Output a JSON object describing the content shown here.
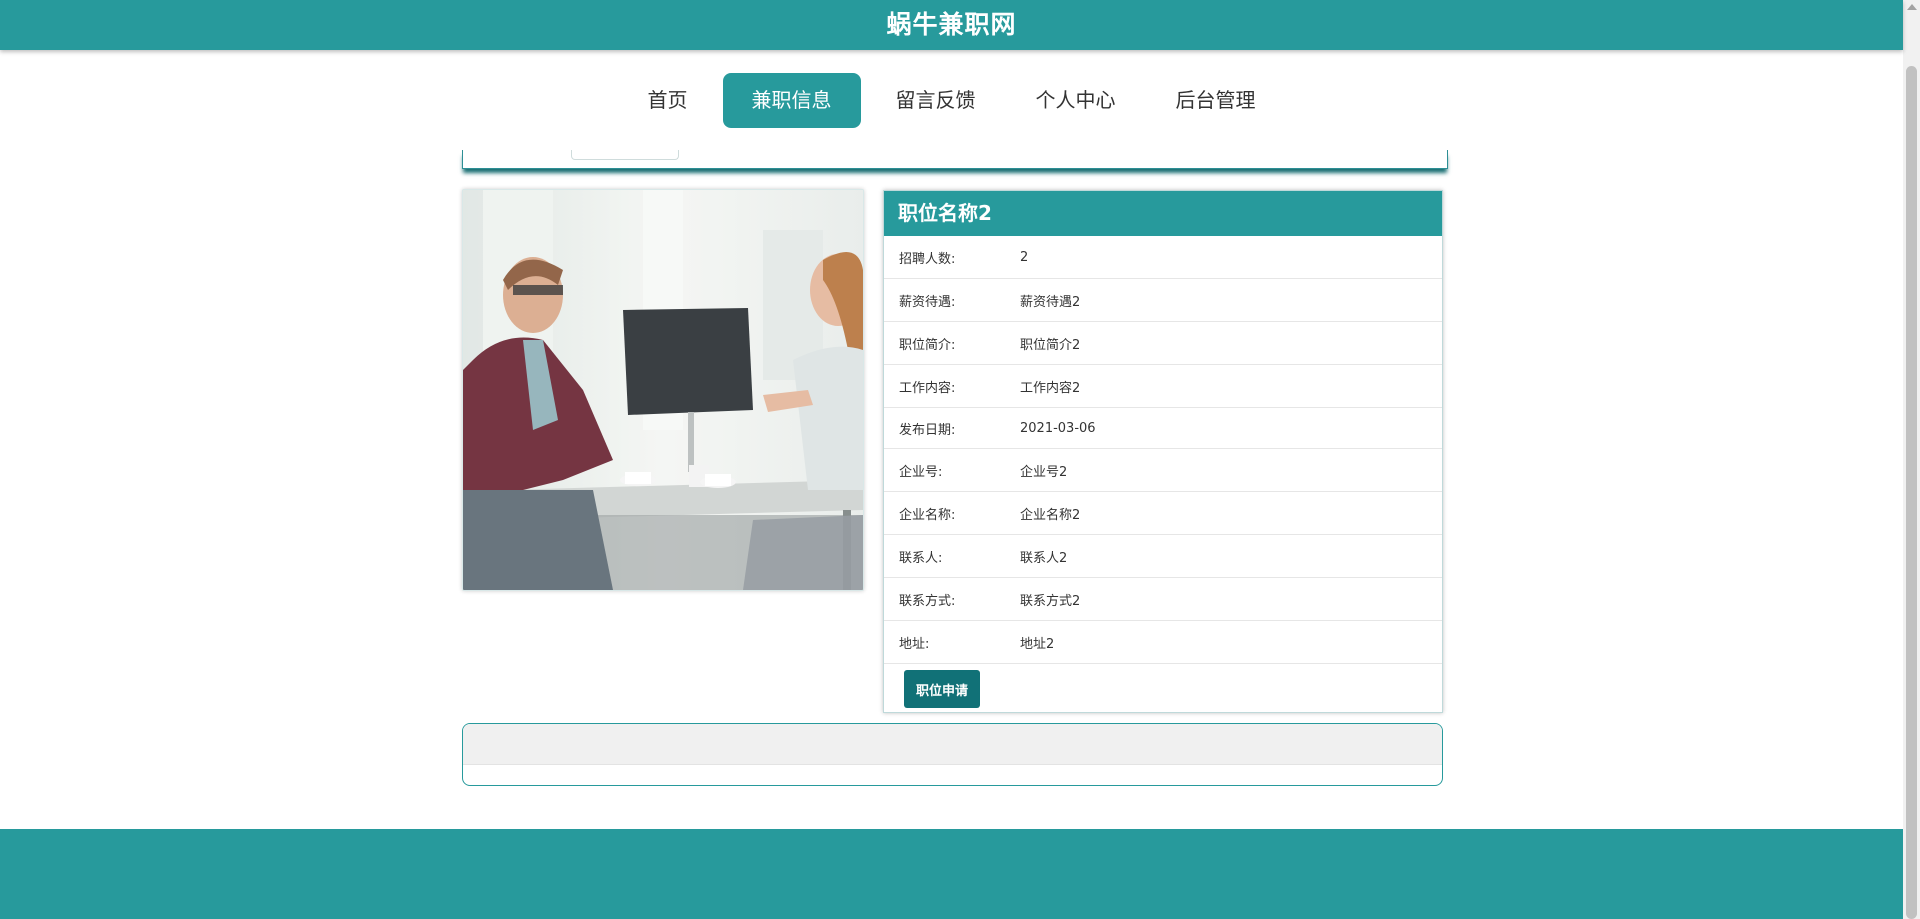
{
  "site": {
    "title": "蜗牛兼职网"
  },
  "nav": [
    {
      "label": "首页",
      "active": false
    },
    {
      "label": "兼职信息",
      "active": true
    },
    {
      "label": "留言反馈",
      "active": false
    },
    {
      "label": "个人中心",
      "active": false
    },
    {
      "label": "后台管理",
      "active": false
    }
  ],
  "job": {
    "title": "职位名称2",
    "fields": [
      {
        "key": "招聘人数:",
        "value": "2"
      },
      {
        "key": "薪资待遇:",
        "value": "薪资待遇2"
      },
      {
        "key": "职位简介:",
        "value": "职位简介2"
      },
      {
        "key": "工作内容:",
        "value": "工作内容2"
      },
      {
        "key": "发布日期:",
        "value": "2021-03-06"
      },
      {
        "key": "企业号:",
        "value": "企业号2"
      },
      {
        "key": "企业名称:",
        "value": "企业名称2"
      },
      {
        "key": "联系人:",
        "value": "联系人2"
      },
      {
        "key": "联系方式:",
        "value": "联系方式2"
      },
      {
        "key": "地址:",
        "value": "地址2"
      }
    ],
    "apply_label": "职位申请"
  },
  "colors": {
    "primary": "#279a9c",
    "button": "#117177"
  },
  "icons": {
    "photo": "office-meeting-photo",
    "scroll": "scroll-up-arrow-icon"
  }
}
